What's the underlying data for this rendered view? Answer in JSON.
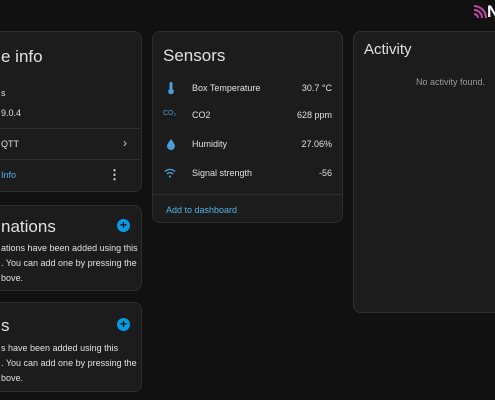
{
  "device_info": {
    "title": "e info",
    "line1": "s",
    "line2": "9.0.4",
    "mqtt_label": "QTT",
    "info_link": "Info"
  },
  "automations": {
    "title": "nations",
    "text_lines": [
      "ations have been added using this",
      ". You can add one by pressing the",
      "bove."
    ]
  },
  "scripts": {
    "title": "s",
    "text_lines": [
      "s have been added using this",
      ". You can add one by pressing the",
      "bove."
    ]
  },
  "sensors": {
    "title": "Sensors",
    "rows": [
      {
        "icon": "thermometer-icon",
        "label": "Box Temperature",
        "value": "30.7 °C"
      },
      {
        "icon": "co2-icon",
        "label": "CO2",
        "value": "628 ppm",
        "icon_text": "CO₂"
      },
      {
        "icon": "water-drop-icon",
        "label": "Humidity",
        "value": "27.06%"
      },
      {
        "icon": "wifi-icon",
        "label": "Signal strength",
        "value": "-56"
      }
    ],
    "add_label": "Add to dashboard"
  },
  "activity": {
    "title": "Activity",
    "empty_text": "No activity found."
  },
  "logo_text": "N"
}
